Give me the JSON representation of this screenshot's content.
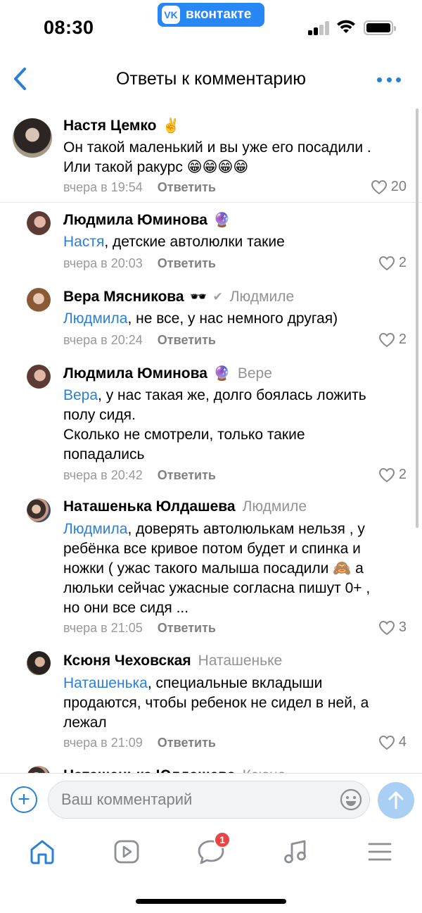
{
  "status_bar": {
    "time": "08:30",
    "app_pill_logo": "vk",
    "app_pill_label": "вконтакте"
  },
  "header": {
    "title": "Ответы к комментарию",
    "back_icon": "chevron-left-icon",
    "more_icon": "more-horizontal-icon"
  },
  "comments": [
    {
      "author": "Настя Цемко",
      "badge": "✌️",
      "reply_to": "",
      "mention": "",
      "text": "Он такой маленький и вы уже его посадили .\nИли такой ракурс 😁😁😁😁",
      "time": "вчера в 19:54",
      "reply_label": "Ответить",
      "likes": "20"
    },
    {
      "author": "Людмила Юминова",
      "badge": "🔮",
      "reply_to": "",
      "mention": "Настя",
      "text": ", детские автолюлки такие",
      "time": "вчера в 20:03",
      "reply_label": "Ответить",
      "likes": "2"
    },
    {
      "author": "Вера Мясникова",
      "badge": "🕶️",
      "reply_to": "Людмиле",
      "mention": "Людмила",
      "text": ", не все, у нас немного другая)",
      "time": "вчера в 20:24",
      "reply_label": "Ответить",
      "likes": "2"
    },
    {
      "author": "Людмила Юминова",
      "badge": "🔮",
      "reply_to": "Вере",
      "mention": "Вера",
      "text": ", у нас такая же, долго боялась ложить\nполу сидя.\nСколько не смотрели, только такие\nпопадались",
      "time": "вчера в 20:42",
      "reply_label": "Ответить",
      "likes": "2"
    },
    {
      "author": "Наташенька Юлдашева",
      "badge": "",
      "reply_to": "Людмиле",
      "mention": "Людмила",
      "text": ", доверять автолюлькам нельзя , у\nребёнка все кривое потом будет и спинка и\nножки ( ужас такого малыша посадили 🙈 а\nлюльки сейчас ужасные согласна пишут 0+ ,\nно они все сидя ...",
      "time": "вчера в 21:05",
      "reply_label": "Ответить",
      "likes": "3"
    },
    {
      "author": "Ксюня Чеховская",
      "badge": "",
      "reply_to": "Наташеньке",
      "mention": "Наташенька",
      "text": ", специальные вкладыши\nпродаются, чтобы ребенок не сидел в ней, а\nлежал",
      "time": "вчера в 21:09",
      "reply_label": "Ответить",
      "likes": "4"
    },
    {
      "author": "Наташенька Юлдашева",
      "badge": "",
      "reply_to": "Ксюне",
      "mention": "",
      "text": "",
      "time": "",
      "reply_label": "",
      "likes": ""
    }
  ],
  "composer": {
    "placeholder": "Ваш комментарий",
    "value": ""
  },
  "tabbar": {
    "tabs": [
      "home-icon",
      "video-icon",
      "messages-icon",
      "music-icon",
      "menu-icon"
    ],
    "messages_badge": "1"
  },
  "colors": {
    "accent": "#2a80d7",
    "vk_brand": "#2787f5",
    "send_button_disabled": "#a9cff5",
    "badge_red": "#e64646",
    "secondary_text": "#9a9a9a"
  }
}
